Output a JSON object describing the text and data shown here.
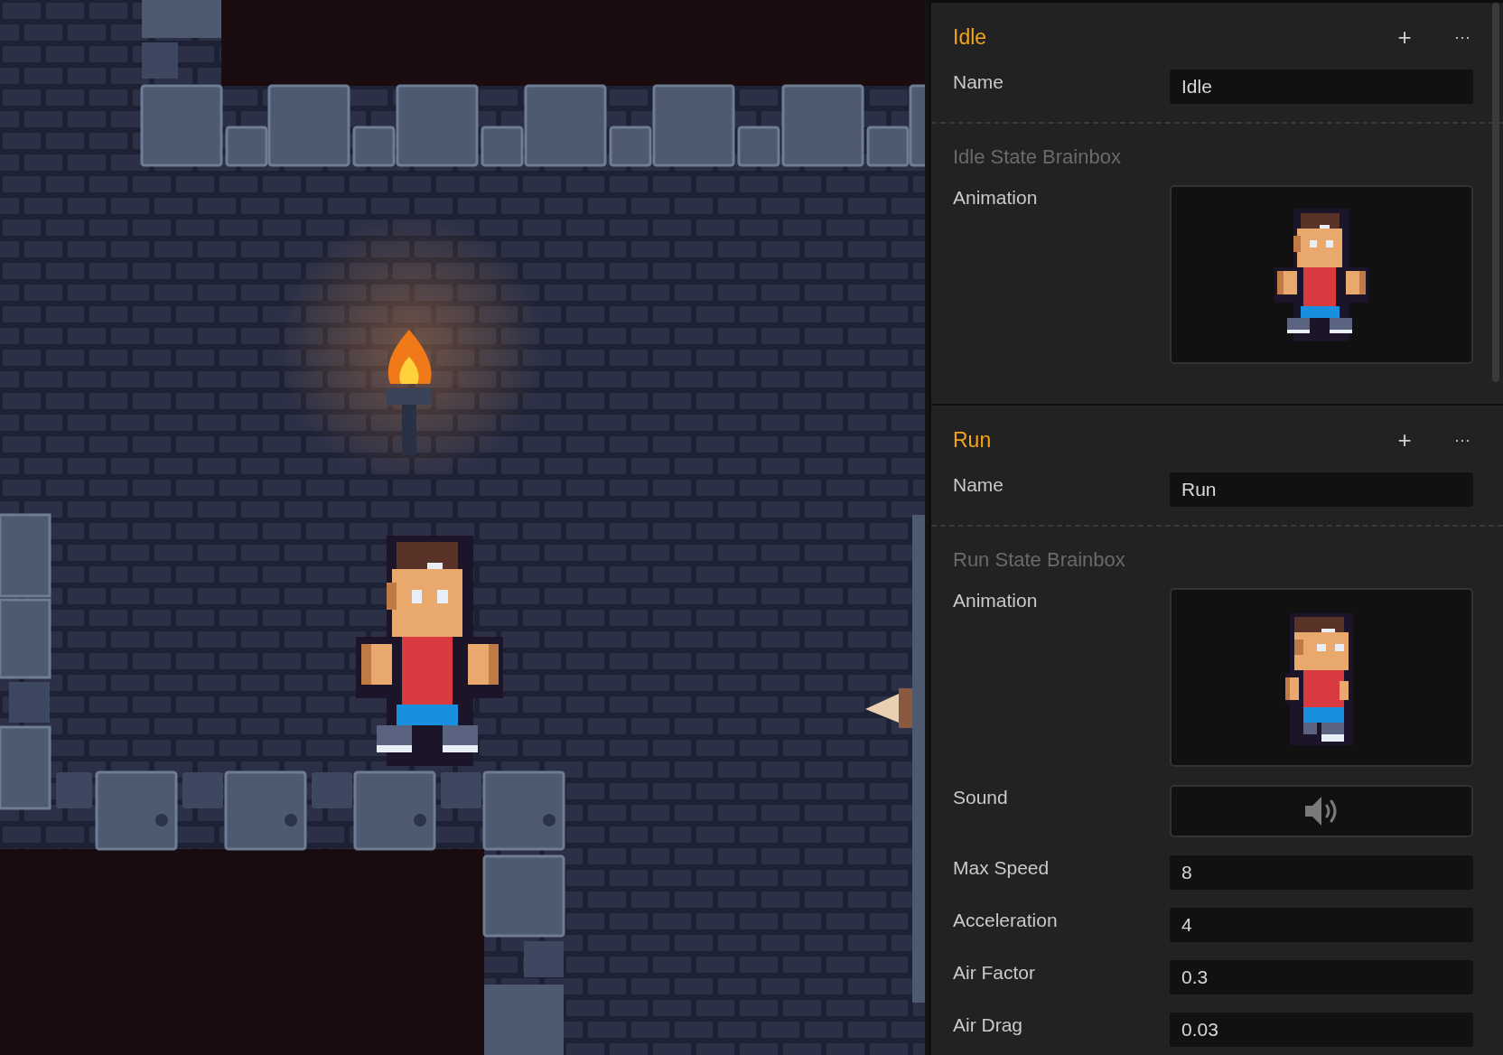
{
  "scene": {
    "kind": "dungeon"
  },
  "inspector": {
    "sections": [
      {
        "title": "Idle",
        "actions": [
          "+",
          "···"
        ],
        "fields": [
          {
            "kind": "text",
            "label": "Name",
            "value": "Idle"
          }
        ],
        "brainbox": {
          "title": "Idle State Brainbox",
          "fields": [
            {
              "kind": "idle",
              "label": "Animation"
            }
          ]
        }
      },
      {
        "title": "Run",
        "actions": [
          "+",
          "···"
        ],
        "fields": [
          {
            "kind": "text",
            "label": "Name",
            "value": "Run"
          }
        ],
        "brainbox": {
          "title": "Run State Brainbox",
          "fields": [
            {
              "kind": "run",
              "label": "Animation"
            },
            {
              "kind": "sound",
              "label": "Sound"
            },
            {
              "kind": "text",
              "label": "Max Speed",
              "value": "8"
            },
            {
              "kind": "text",
              "label": "Acceleration",
              "value": "4"
            },
            {
              "kind": "text",
              "label": "Air Factor",
              "value": "0.3"
            },
            {
              "kind": "text",
              "label": "Air Drag",
              "value": "0.03"
            }
          ]
        }
      }
    ]
  }
}
